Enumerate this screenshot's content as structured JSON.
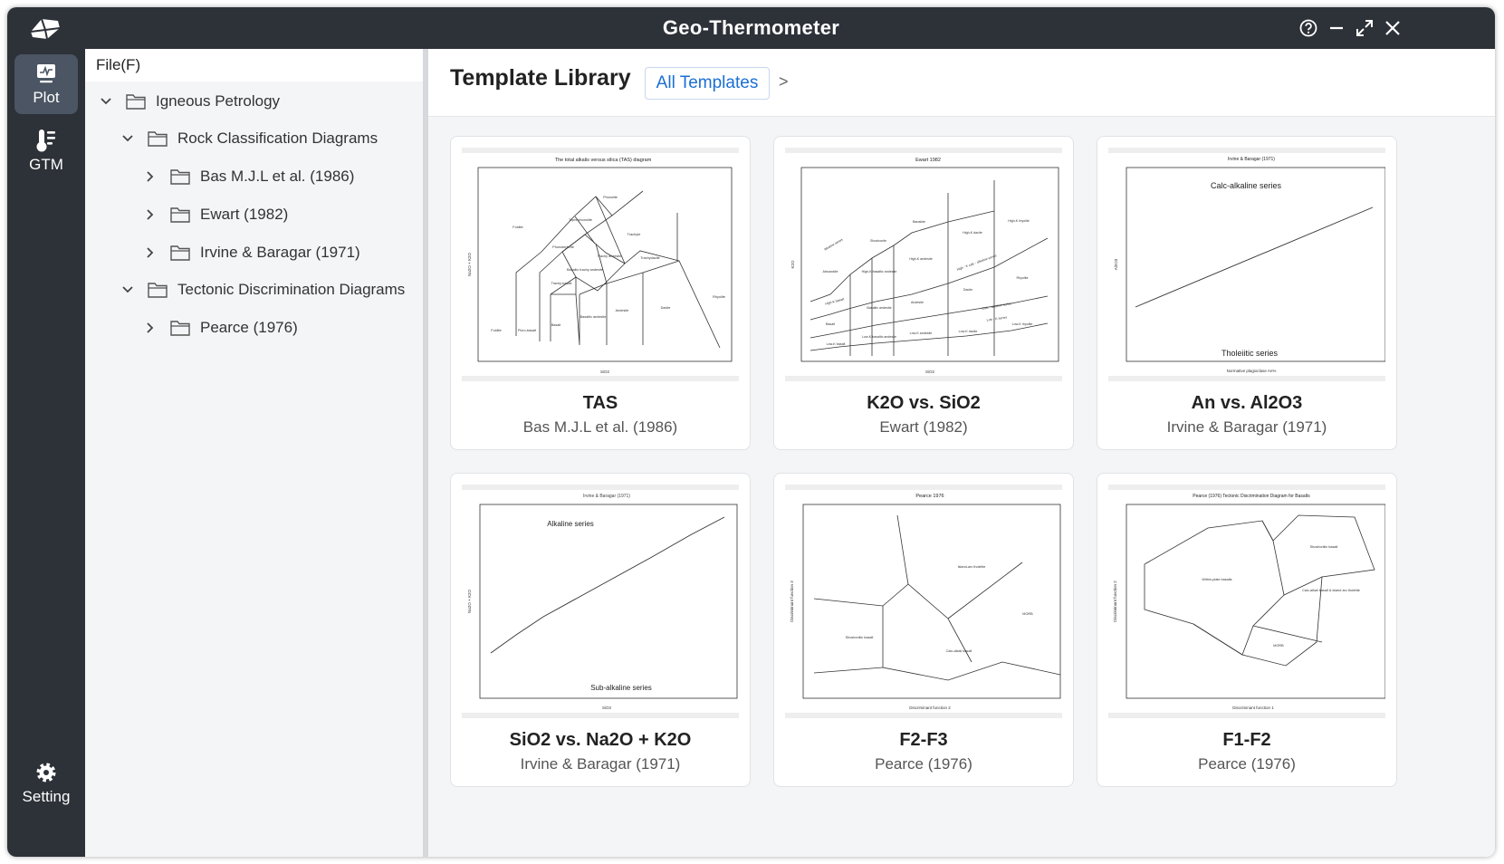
{
  "app": {
    "title": "Geo-Thermometer"
  },
  "sidebar": {
    "items": [
      {
        "label": "Plot",
        "icon": "plot-icon",
        "active": true
      },
      {
        "label": "GTM",
        "icon": "thermometer-icon"
      },
      {
        "label": "Setting",
        "icon": "gear-icon"
      }
    ]
  },
  "menu": {
    "file": "File(F)"
  },
  "tree": {
    "igneous": "Igneous Petrology",
    "rock": "Rock Classification Diagrams",
    "bas": "Bas M.J.L et al. (1986)",
    "ewart": "Ewart (1982)",
    "irvine": "Irvine & Baragar (1971)",
    "tectonic": "Tectonic Discrimination Diagrams",
    "pearce": "Pearce (1976)"
  },
  "library": {
    "title": "Template Library",
    "filter": "All Templates",
    "more": ">",
    "cards": [
      {
        "title": "TAS",
        "subtitle": "Bas M.J.L et al. (1986)",
        "thumb_title": "The total alkalis versus silica (TAS) diagram",
        "xlabel": "SiO2",
        "ylabel": "Na2O + K2O",
        "labels": [
          "Phonolite",
          "Tephriphonolite",
          "Foidite",
          "Phonotephrite",
          "Trachyte",
          "Trachy andesite",
          "Trachydacite",
          "Basaltic trachy andesite",
          "Trachy-basalt",
          "Rhyolite",
          "Andesite",
          "Dacite",
          "Basaltic andesite",
          "Basalt",
          "Picro-basalt",
          "Foidite"
        ]
      },
      {
        "title": "K2O vs. SiO2",
        "subtitle": "Ewart (1982)",
        "thumb_title": "Ewart 1982",
        "xlabel": "SiO2",
        "ylabel": "K2O",
        "labels": [
          "Alkaline series",
          "Shoshonite",
          "Banakite",
          "High-K dacite",
          "High-K rhyolite",
          "Absarokite",
          "High-K basaltic andesite",
          "High-K andesite",
          "High - K calc - alkaline series",
          "Rhyolite",
          "High-K basalt",
          "Dacite",
          "Andesite",
          "Basaltic andesite",
          "Calc - alkaline series",
          "Basalt",
          "Low - K series",
          "Low-K rhyolite",
          "Low-K basalt",
          "Low-K basaltic andesite",
          "Low-K andesite",
          "Low-K dacite"
        ]
      },
      {
        "title": "An vs. Al2O3",
        "subtitle": "Irvine & Baragar (1971)",
        "thumb_title": "Irvine & Baragar (1971)",
        "xlabel": "Normative plagioclase An%",
        "ylabel": "Al2O3",
        "labels": [
          "Calc-alkaline series",
          "Tholeiitic series"
        ]
      },
      {
        "title": "SiO2 vs. Na2O + K2O",
        "subtitle": "Irvine & Baragar (1971)",
        "thumb_title": "Irvine & Baragar (1971)",
        "xlabel": "SiO2",
        "ylabel": "Na2O + K2O",
        "labels": [
          "Alkaline series",
          "Sub-alkaline series"
        ]
      },
      {
        "title": "F2-F3",
        "subtitle": "Pearce (1976)",
        "thumb_title": "Pearce 1976",
        "xlabel": "Discriminant function 2",
        "ylabel": "Discriminant function 3",
        "labels": [
          "Island-arc tholeiite",
          "MORB",
          "Shoshonitic basalt",
          "Calc-alkali basalt"
        ]
      },
      {
        "title": "F1-F2",
        "subtitle": "Pearce (1976)",
        "thumb_title": "Pearce (1976) Tectonic Discrimination Diagram for Basalts",
        "xlabel": "Discriminant function 1",
        "ylabel": "Discriminant function 2",
        "labels": [
          "Shoshonitic basalt",
          "Within-plate basalts",
          "Calc-alkali basalt & island arc tholeiite",
          "MORB"
        ]
      }
    ]
  },
  "colors": {
    "chrome": "#2d3138",
    "active_nav": "#4b5563",
    "accent": "#1a6fd4",
    "panel": "#f4f5f7"
  }
}
